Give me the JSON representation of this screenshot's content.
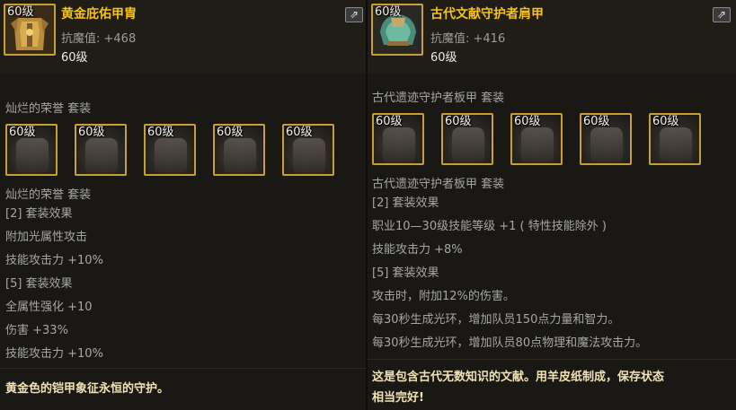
{
  "left": {
    "level_badge": "60级",
    "title": "黄金庇佑甲胄",
    "stat": "抗魔值: +468",
    "level_text": "60级",
    "set_header": "灿烂的荣誉  套装",
    "slots": [
      "60级",
      "60级",
      "60级",
      "60级",
      "60级"
    ],
    "set_name": "灿烂的荣誉  套装",
    "effects": [
      "[2] 套装效果",
      "附加光属性攻击",
      "技能攻击力 +10%",
      "[5] 套装效果",
      "全属性强化 +10",
      "伤害 +33%",
      "技能攻击力 +10%"
    ],
    "description": "黄金色的铠甲象征永恒的守护。"
  },
  "right": {
    "level_badge": "60级",
    "title": "古代文献守护者肩甲",
    "stat": "抗魔值: +416",
    "level_text": "60级",
    "set_header": "古代遗迹守护者板甲  套装",
    "slots": [
      "60级",
      "60级",
      "60级",
      "60级",
      "60级"
    ],
    "set_name": "古代遗迹守护者板甲  套装",
    "effects": [
      "[2] 套装效果",
      "职业10—30级技能等级 +1 ( 特性技能除外 )",
      "技能攻击力 +8%",
      "[5] 套装效果",
      "攻击时，附加12%的伤害。",
      "每30秒生成光环，增加队员150点力量和智力。",
      "每30秒生成光环，增加队员80点物理和魔法攻击力。"
    ],
    "description_lines": [
      "这是包含古代无数知识的文献。用羊皮纸制成，保存状态",
      "相当完好!"
    ]
  },
  "colors": {
    "title": "#f4c21a",
    "border": "#c6a034",
    "desc": "#f0e2b2"
  },
  "icons": {
    "share": "share-icon"
  }
}
